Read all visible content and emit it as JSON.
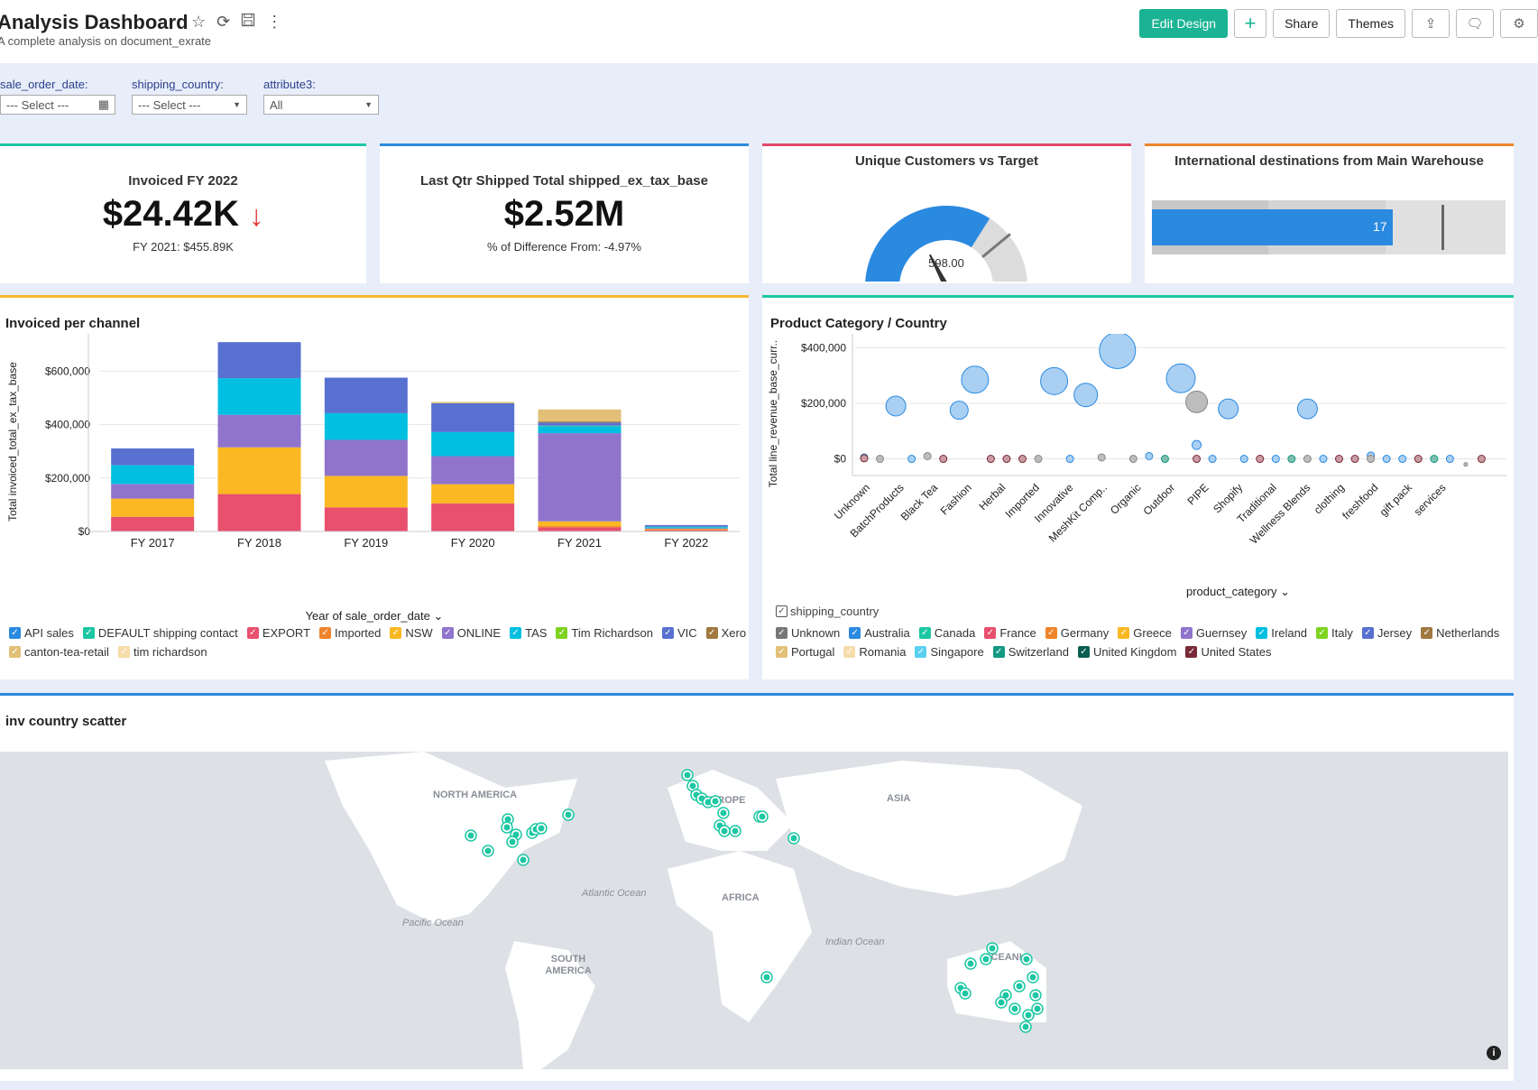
{
  "header": {
    "title": "Analysis Dashboard",
    "subtitle": "A complete analysis on document_exrate",
    "icons": [
      "star-icon",
      "refresh-icon",
      "save-icon",
      "more-icon"
    ],
    "buttons": {
      "edit_design": "Edit Design",
      "add": "+",
      "share": "Share",
      "themes": "Themes"
    },
    "icon_buttons": [
      "export-icon",
      "comment-icon",
      "settings-icon"
    ]
  },
  "filters": [
    {
      "label": "sale_order_date:",
      "value": "--- Select ---",
      "icon": "calendar-icon"
    },
    {
      "label": "shipping_country:",
      "value": "--- Select ---",
      "icon": "dropdown-icon"
    },
    {
      "label": "attribute3:",
      "value": "All",
      "icon": "dropdown-icon"
    }
  ],
  "kpis": {
    "invoiced": {
      "title": "Invoiced FY 2022",
      "value": "$24.42K",
      "trend": "↓",
      "sub": "FY 2021: $455.89K",
      "accent": "#1cc7a3"
    },
    "shipped": {
      "title": "Last Qtr Shipped Total shipped_ex_tax_base",
      "value": "$2.52M",
      "sub": "% of Difference From: -4.97%",
      "accent": "#2a8ae0"
    },
    "gauge": {
      "title": "Unique Customers vs Target",
      "value_label": "598.00",
      "fraction": 0.68,
      "target_fraction": 0.78,
      "accent": "#e04a6c"
    },
    "bullet": {
      "title": "International destinations from Main Warehouse",
      "value_label": "17",
      "value_fraction": 0.68,
      "target_fraction": 0.82,
      "accent": "#f0842c"
    }
  },
  "invoiced_chart": {
    "title": "Invoiced per channel",
    "accent": "#f5b82e",
    "x_axis_label": "Year of sale_order_date",
    "legend": [
      {
        "label": "API sales",
        "color": "#2a8ae0"
      },
      {
        "label": "DEFAULT shipping contact",
        "color": "#1cc7a3"
      },
      {
        "label": "EXPORT",
        "color": "#e8506e"
      },
      {
        "label": "Imported",
        "color": "#f0842c"
      },
      {
        "label": "NSW",
        "color": "#fbb822"
      },
      {
        "label": "ONLINE",
        "color": "#9074cc"
      },
      {
        "label": "TAS",
        "color": "#00bfe0"
      },
      {
        "label": "Tim Richardson",
        "color": "#7ed321"
      },
      {
        "label": "VIC",
        "color": "#5870d0"
      },
      {
        "label": "Xero",
        "color": "#a07840"
      },
      {
        "label": "canton-tea-retail",
        "color": "#e2c078"
      },
      {
        "label": "tim richardson",
        "color": "#f5dcaa"
      }
    ]
  },
  "bubble_chart": {
    "title": "Product Category / Country",
    "accent": "#1cc7a3",
    "x_axis_label": "product_category",
    "legend_title": "shipping_country",
    "legend": [
      {
        "label": "Unknown",
        "color": "#777777"
      },
      {
        "label": "Australia",
        "color": "#2a8ae0"
      },
      {
        "label": "Canada",
        "color": "#1cc7a3"
      },
      {
        "label": "France",
        "color": "#e8506e"
      },
      {
        "label": "Germany",
        "color": "#f0842c"
      },
      {
        "label": "Greece",
        "color": "#fbb822"
      },
      {
        "label": "Guernsey",
        "color": "#9074cc"
      },
      {
        "label": "Ireland",
        "color": "#00bfe0"
      },
      {
        "label": "Italy",
        "color": "#7ed321"
      },
      {
        "label": "Jersey",
        "color": "#5870d0"
      },
      {
        "label": "Netherlands",
        "color": "#a07840"
      },
      {
        "label": "Portugal",
        "color": "#e2c078"
      },
      {
        "label": "Romania",
        "color": "#f5dcaa"
      },
      {
        "label": "Singapore",
        "color": "#5ad0f0"
      },
      {
        "label": "Switzerland",
        "color": "#129a82"
      },
      {
        "label": "United Kingdom",
        "color": "#0b5e50"
      },
      {
        "label": "United States",
        "color": "#7a2a36"
      }
    ]
  },
  "map": {
    "title": "inv country scatter",
    "accent": "#2a8ae0",
    "labels": [
      "NORTH AMERICA",
      "EUROPE",
      "ASIA",
      "AFRICA",
      "SOUTH AMERICA",
      "OCEANIA"
    ],
    "oceans": [
      "Atlantic Ocean",
      "Pacific Ocean",
      "Indian Ocean"
    ],
    "info_icon": "info-icon"
  },
  "chart_data": [
    {
      "type": "bar",
      "title": "Invoiced per channel",
      "xlabel": "Year of sale_order_date",
      "ylabel": "Total invoiced_total_ex_tax_base",
      "categories": [
        "FY 2017",
        "FY 2018",
        "FY 2019",
        "FY 2020",
        "FY 2021",
        "FY 2022"
      ],
      "ylim": [
        0,
        740000
      ],
      "yticks": [
        0,
        200000,
        400000,
        600000
      ],
      "ytick_labels": [
        "$0",
        "$200,000",
        "$400,000",
        "$600,000"
      ],
      "stacked": true,
      "series": [
        {
          "name": "EXPORT",
          "color": "#e8506e",
          "values": [
            55000,
            140000,
            90000,
            105000,
            15000,
            5000
          ]
        },
        {
          "name": "Imported",
          "color": "#f0842c",
          "values": [
            0,
            0,
            0,
            0,
            5000,
            3000
          ]
        },
        {
          "name": "NSW",
          "color": "#fbb822",
          "values": [
            68000,
            175000,
            118000,
            72000,
            18000,
            2000
          ]
        },
        {
          "name": "ONLINE",
          "color": "#9074cc",
          "values": [
            55000,
            122000,
            135000,
            105000,
            330000,
            2000
          ]
        },
        {
          "name": "TAS",
          "color": "#00bfe0",
          "values": [
            70000,
            137000,
            100000,
            90000,
            25000,
            4000
          ]
        },
        {
          "name": "DEFAULT shipping contact",
          "color": "#1cc7a3",
          "values": [
            0,
            0,
            0,
            0,
            3000,
            2000
          ]
        },
        {
          "name": "VIC",
          "color": "#5870d0",
          "values": [
            63000,
            135000,
            133000,
            108000,
            12000,
            6000
          ]
        },
        {
          "name": "Xero",
          "color": "#a07840",
          "values": [
            0,
            0,
            0,
            0,
            4000,
            0
          ]
        },
        {
          "name": "canton-tea-retail",
          "color": "#e2c078",
          "values": [
            0,
            0,
            0,
            5000,
            45000,
            0
          ]
        }
      ]
    },
    {
      "type": "scatter",
      "title": "Product Category / Country",
      "xlabel": "product_category",
      "ylabel": "Total line_revenue_base_curr..",
      "ylim": [
        -60000,
        450000
      ],
      "yticks": [
        0,
        200000,
        400000
      ],
      "ytick_labels": [
        "$0",
        "$200,000",
        "$400,000"
      ],
      "categories": [
        "Unknown",
        "BatchProducts",
        "Black Tea",
        "Fashion",
        "Herbal",
        "Imported",
        "Innovative",
        "MeshKit Comp..",
        "Organic",
        "Outdoor",
        "PIPE",
        "Shopify",
        "Traditional",
        "Wellness Blends",
        "clothing",
        "freshfood",
        "gift pack",
        "services"
      ],
      "points": [
        {
          "x": 0,
          "y": 5000,
          "r": 4,
          "country": "Australia"
        },
        {
          "x": 0,
          "y": 2000,
          "r": 4,
          "country": "United States"
        },
        {
          "x": 0.5,
          "y": 0,
          "r": 4,
          "country": "Unknown"
        },
        {
          "x": 1,
          "y": 190000,
          "r": 11,
          "country": "Australia"
        },
        {
          "x": 1.5,
          "y": 0,
          "r": 4,
          "country": "Australia"
        },
        {
          "x": 2,
          "y": 10000,
          "r": 4,
          "country": "Unknown"
        },
        {
          "x": 2.5,
          "y": 0,
          "r": 4,
          "country": "United States"
        },
        {
          "x": 3,
          "y": 175000,
          "r": 10,
          "country": "Australia"
        },
        {
          "x": 3.5,
          "y": 285000,
          "r": 15,
          "country": "Australia"
        },
        {
          "x": 4,
          "y": 0,
          "r": 4,
          "country": "United States"
        },
        {
          "x": 4.5,
          "y": 0,
          "r": 4,
          "country": "United States"
        },
        {
          "x": 5,
          "y": 0,
          "r": 4,
          "country": "United States"
        },
        {
          "x": 5.5,
          "y": 0,
          "r": 4,
          "country": "Unknown"
        },
        {
          "x": 6,
          "y": 280000,
          "r": 15,
          "country": "Australia"
        },
        {
          "x": 6.5,
          "y": 0,
          "r": 4,
          "country": "Australia"
        },
        {
          "x": 7,
          "y": 230000,
          "r": 13,
          "country": "Australia"
        },
        {
          "x": 7.5,
          "y": 5000,
          "r": 4,
          "country": "Unknown"
        },
        {
          "x": 8,
          "y": 390000,
          "r": 20,
          "country": "Australia"
        },
        {
          "x": 8.5,
          "y": 0,
          "r": 4,
          "country": "Unknown"
        },
        {
          "x": 9,
          "y": 10000,
          "r": 4,
          "country": "Australia"
        },
        {
          "x": 9.5,
          "y": 0,
          "r": 4,
          "country": "Switzerland"
        },
        {
          "x": 10,
          "y": 290000,
          "r": 16,
          "country": "Australia"
        },
        {
          "x": 10.5,
          "y": 205000,
          "r": 12,
          "country": "Unknown"
        },
        {
          "x": 10.5,
          "y": 50000,
          "r": 5,
          "country": "Australia"
        },
        {
          "x": 10.5,
          "y": 0,
          "r": 4,
          "country": "United States"
        },
        {
          "x": 11,
          "y": 0,
          "r": 4,
          "country": "Australia"
        },
        {
          "x": 11.5,
          "y": 180000,
          "r": 11,
          "country": "Australia"
        },
        {
          "x": 12,
          "y": 0,
          "r": 4,
          "country": "Australia"
        },
        {
          "x": 12.5,
          "y": 0,
          "r": 4,
          "country": "United States"
        },
        {
          "x": 13,
          "y": 0,
          "r": 4,
          "country": "Australia"
        },
        {
          "x": 13.5,
          "y": 0,
          "r": 4,
          "country": "Switzerland"
        },
        {
          "x": 14,
          "y": 180000,
          "r": 11,
          "country": "Australia"
        },
        {
          "x": 14,
          "y": 0,
          "r": 4,
          "country": "Unknown"
        },
        {
          "x": 14.5,
          "y": 0,
          "r": 4,
          "country": "Australia"
        },
        {
          "x": 15,
          "y": 0,
          "r": 4,
          "country": "United States"
        },
        {
          "x": 15.5,
          "y": 0,
          "r": 4,
          "country": "United States"
        },
        {
          "x": 16,
          "y": 12000,
          "r": 4,
          "country": "Australia"
        },
        {
          "x": 16,
          "y": 0,
          "r": 4,
          "country": "Unknown"
        },
        {
          "x": 16.5,
          "y": 0,
          "r": 4,
          "country": "Australia"
        },
        {
          "x": 17,
          "y": 0,
          "r": 4,
          "country": "Australia"
        },
        {
          "x": 17.5,
          "y": 0,
          "r": 4,
          "country": "United States"
        },
        {
          "x": 18,
          "y": 0,
          "r": 4,
          "country": "Switzerland"
        },
        {
          "x": 18.5,
          "y": 0,
          "r": 4,
          "country": "Australia"
        },
        {
          "x": 19,
          "y": -20000,
          "r": 2,
          "country": "Unknown"
        },
        {
          "x": 19.5,
          "y": 0,
          "r": 4,
          "country": "United States"
        }
      ]
    }
  ]
}
